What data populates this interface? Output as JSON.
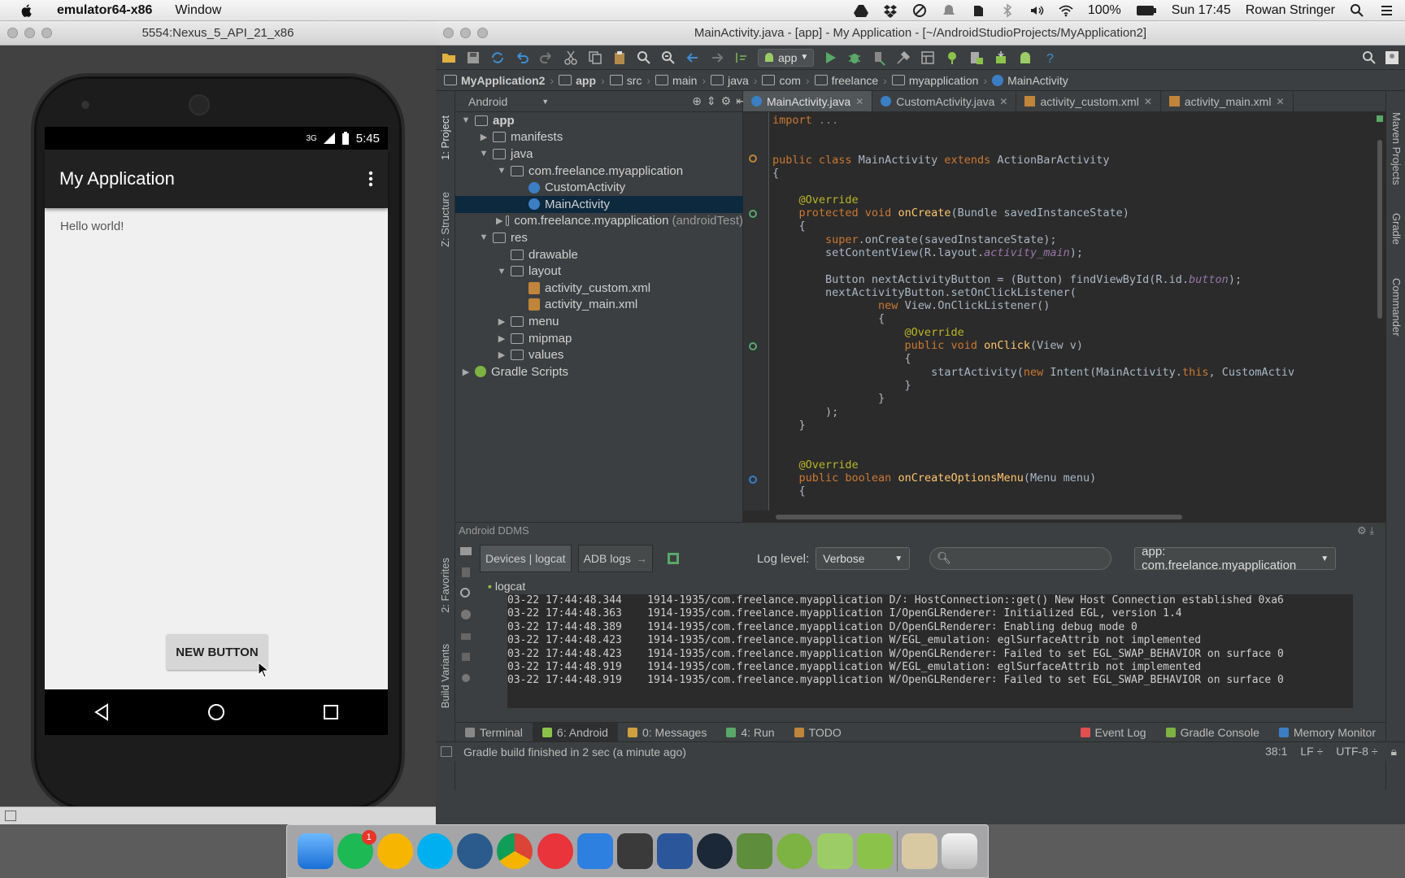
{
  "menubar": {
    "app_name": "emulator64-x86",
    "menu_window": "Window",
    "battery": "100%",
    "clock": "Sun 17:45",
    "user": "Rowan Stringer"
  },
  "emulator": {
    "title": "5554:Nexus_5_API_21_x86",
    "status_time": "5:45",
    "network": "3G",
    "app_title": "My Application",
    "hello_text": "Hello world!",
    "button_label": "NEW BUTTON"
  },
  "ide": {
    "title": "MainActivity.java - [app] - My Application - [~/AndroidStudioProjects/MyApplication2]",
    "run_config": "app",
    "breadcrumbs": [
      "MyApplication2",
      "app",
      "src",
      "main",
      "java",
      "com",
      "freelance",
      "myapplication",
      "MainActivity"
    ],
    "left_tools": [
      "1: Project",
      "Z: Structure",
      "2: Favorites",
      "Build Variants"
    ],
    "right_tools": [
      "Maven Projects",
      "Gradle",
      "Commander"
    ],
    "project_view": "Android",
    "tree": [
      {
        "label": "app",
        "depth": 0,
        "arrow": "▼",
        "icon": "folder",
        "bold": true
      },
      {
        "label": "manifests",
        "depth": 1,
        "arrow": "▶",
        "icon": "folder"
      },
      {
        "label": "java",
        "depth": 1,
        "arrow": "▼",
        "icon": "folder"
      },
      {
        "label": "com.freelance.myapplication",
        "depth": 2,
        "arrow": "▼",
        "icon": "folder"
      },
      {
        "label": "CustomActivity",
        "depth": 3,
        "arrow": "",
        "icon": "class"
      },
      {
        "label": "MainActivity",
        "depth": 3,
        "arrow": "",
        "icon": "class",
        "selected": true
      },
      {
        "label": "com.freelance.myapplication",
        "suffix": "(androidTest)",
        "depth": 2,
        "arrow": "▶",
        "icon": "folder"
      },
      {
        "label": "res",
        "depth": 1,
        "arrow": "▼",
        "icon": "folder"
      },
      {
        "label": "drawable",
        "depth": 2,
        "arrow": "",
        "icon": "folder"
      },
      {
        "label": "layout",
        "depth": 2,
        "arrow": "▼",
        "icon": "folder"
      },
      {
        "label": "activity_custom.xml",
        "depth": 3,
        "arrow": "",
        "icon": "xml"
      },
      {
        "label": "activity_main.xml",
        "depth": 3,
        "arrow": "",
        "icon": "xml"
      },
      {
        "label": "menu",
        "depth": 2,
        "arrow": "▶",
        "icon": "folder"
      },
      {
        "label": "mipmap",
        "depth": 2,
        "arrow": "▶",
        "icon": "folder"
      },
      {
        "label": "values",
        "depth": 2,
        "arrow": "▶",
        "icon": "folder"
      },
      {
        "label": "Gradle Scripts",
        "depth": 0,
        "arrow": "▶",
        "icon": "gradle"
      }
    ],
    "editor_tabs": [
      {
        "label": "MainActivity.java",
        "active": true
      },
      {
        "label": "CustomActivity.java"
      },
      {
        "label": "activity_custom.xml"
      },
      {
        "label": "activity_main.xml"
      }
    ],
    "code_lines": [
      [
        [
          "kw",
          "import "
        ],
        [
          "fo",
          "..."
        ]
      ],
      [],
      [],
      [
        [
          "kw",
          "public class "
        ],
        [
          "",
          "MainActivity "
        ],
        [
          "kw",
          "extends "
        ],
        [
          "",
          "ActionBarActivity"
        ]
      ],
      [
        [
          "",
          "{"
        ]
      ],
      [],
      [
        [
          "an",
          "    @Override"
        ]
      ],
      [
        [
          "kw",
          "    protected void "
        ],
        [
          "fn",
          "onCreate"
        ],
        [
          "",
          "(Bundle savedInstanceState)"
        ]
      ],
      [
        [
          "",
          "    {"
        ]
      ],
      [
        [
          "kw",
          "        super"
        ],
        [
          "",
          ".onCreate(savedInstanceState);"
        ]
      ],
      [
        [
          "",
          "        setContentView(R.layout."
        ],
        [
          "it",
          "activity_main"
        ],
        [
          "",
          ");"
        ]
      ],
      [],
      [
        [
          "",
          "        Button nextActivityButton = (Button) findViewById(R.id."
        ],
        [
          "it",
          "button"
        ],
        [
          "",
          ");"
        ]
      ],
      [
        [
          "",
          "        nextActivityButton.setOnClickListener("
        ]
      ],
      [
        [
          "kw",
          "                new "
        ],
        [
          "",
          "View.OnClickListener()"
        ]
      ],
      [
        [
          "",
          "                {"
        ]
      ],
      [
        [
          "an",
          "                    @Override"
        ]
      ],
      [
        [
          "kw",
          "                    public void "
        ],
        [
          "fn",
          "onClick"
        ],
        [
          "",
          "(View v)"
        ]
      ],
      [
        [
          "",
          "                    {"
        ]
      ],
      [
        [
          "",
          "                        startActivity("
        ],
        [
          "kw",
          "new "
        ],
        [
          "",
          "Intent(MainActivity."
        ],
        [
          "kw",
          "this"
        ],
        [
          "",
          ", CustomActiv"
        ]
      ],
      [
        [
          "",
          "                    }"
        ]
      ],
      [
        [
          "",
          "                }"
        ]
      ],
      [
        [
          "",
          "        );"
        ]
      ],
      [
        [
          "",
          "    }"
        ]
      ],
      [],
      [],
      [
        [
          "an",
          "    @Override"
        ]
      ],
      [
        [
          "kw",
          "    public boolean "
        ],
        [
          "fn",
          "onCreateOptionsMenu"
        ],
        [
          "",
          "(Menu menu)"
        ]
      ],
      [
        [
          "",
          "    {"
        ]
      ]
    ],
    "ddms": {
      "title": "Android DDMS",
      "tab_devices": "Devices | logcat",
      "tab_adb": "ADB logs",
      "log_level_label": "Log level:",
      "log_level": "Verbose",
      "filter_app": "app: com.freelance.myapplication",
      "logcat_label": "logcat",
      "logs": [
        "03-22 17:44:48.344    1914-1935/com.freelance.myapplication D/∶ HostConnection::get() New Host Connection established 0xa6",
        "03-22 17:44:48.363    1914-1935/com.freelance.myapplication I/OpenGLRenderer∶ Initialized EGL, version 1.4",
        "03-22 17:44:48.389    1914-1935/com.freelance.myapplication D/OpenGLRenderer∶ Enabling debug mode 0",
        "03-22 17:44:48.423    1914-1935/com.freelance.myapplication W/EGL_emulation∶ eglSurfaceAttrib not implemented",
        "03-22 17:44:48.423    1914-1935/com.freelance.myapplication W/OpenGLRenderer∶ Failed to set EGL_SWAP_BEHAVIOR on surface 0",
        "03-22 17:44:48.919    1914-1935/com.freelance.myapplication W/EGL_emulation∶ eglSurfaceAttrib not implemented",
        "03-22 17:44:48.919    1914-1935/com.freelance.myapplication W/OpenGLRenderer∶ Failed to set EGL_SWAP_BEHAVIOR on surface 0"
      ]
    },
    "tool_tabs": [
      "Terminal",
      "6: Android",
      "0: Messages",
      "4: Run",
      "TODO"
    ],
    "tool_tabs_right": [
      "Event Log",
      "Gradle Console",
      "Memory Monitor"
    ],
    "status_text": "Gradle build finished in 2 sec (a minute ago)",
    "status_pos": "38:1",
    "status_lf": "LF ÷",
    "status_enc": "UTF-8 ÷"
  },
  "dock_badge": "1",
  "colors": {
    "accent_select": "#0d293e",
    "keyword": "#cc7832",
    "annotation": "#bbb529",
    "method": "#ffc66d"
  }
}
